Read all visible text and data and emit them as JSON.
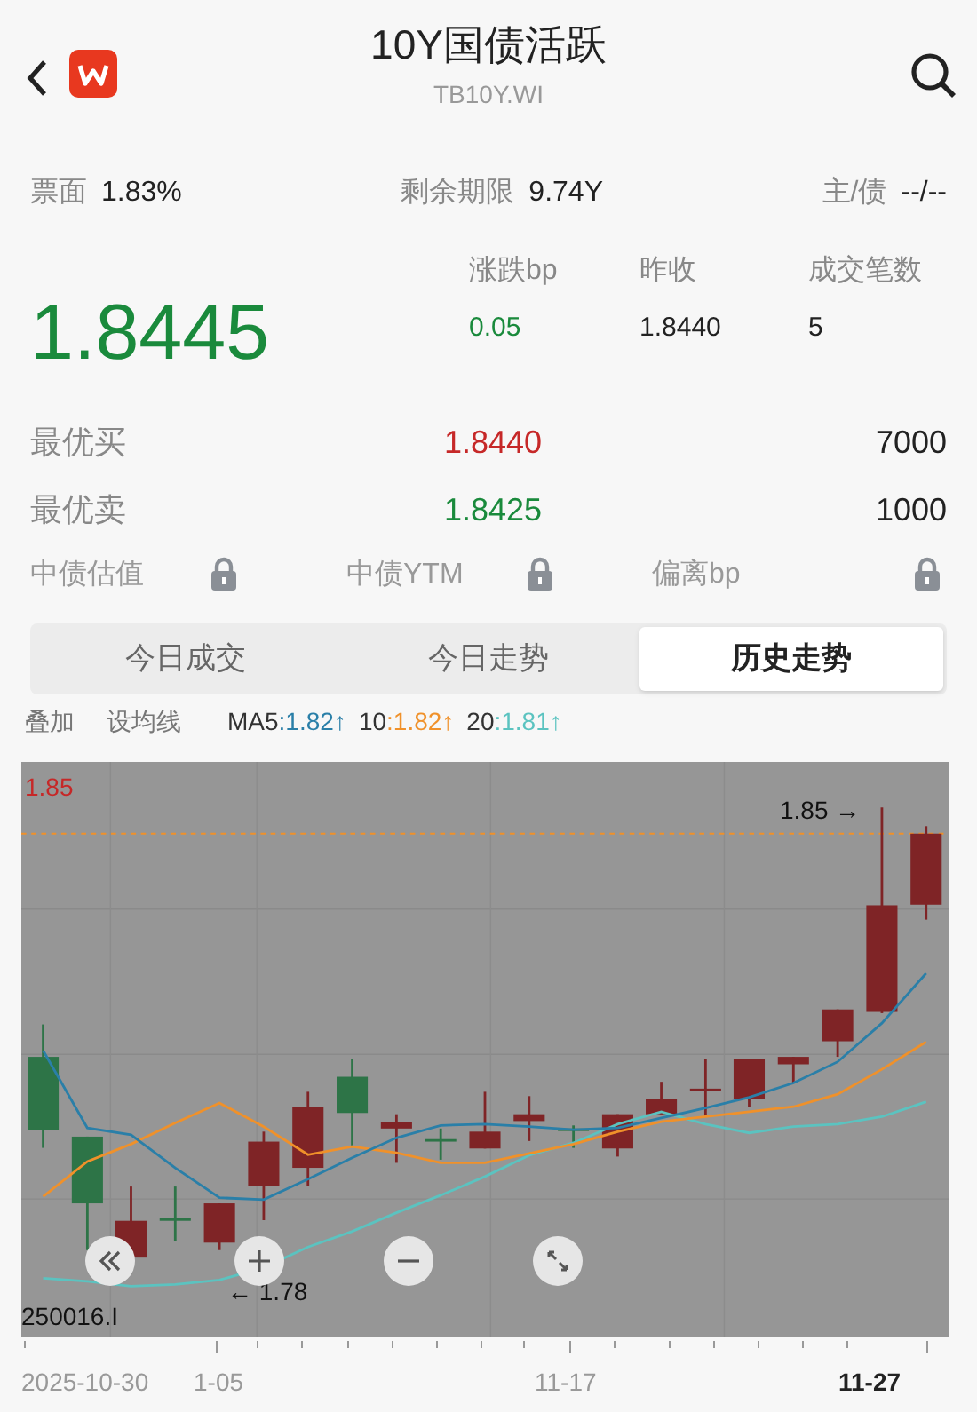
{
  "header": {
    "title": "10Y国债活跃",
    "subtitle": "TB10Y.WI"
  },
  "info": [
    {
      "label": "票面",
      "value": "1.83%"
    },
    {
      "label": "剩余期限",
      "value": "9.74Y"
    },
    {
      "label": "主/债",
      "value": "--/--"
    }
  ],
  "quote": {
    "price": "1.8445",
    "stats": [
      {
        "label": "涨跌bp",
        "value": "0.05",
        "kind": "change"
      },
      {
        "label": "昨收",
        "value": "1.8440",
        "kind": "plain"
      },
      {
        "label": "成交笔数",
        "value": "5",
        "kind": "plain"
      }
    ]
  },
  "book": [
    {
      "label": "最优买",
      "price": "1.8440",
      "color": "#c62828",
      "volume": "7000"
    },
    {
      "label": "最优卖",
      "price": "1.8425",
      "color": "#1a8a3c",
      "volume": "1000"
    }
  ],
  "locked": [
    {
      "label": "中债估值",
      "locked": true
    },
    {
      "label": "中债YTM",
      "locked": true
    },
    {
      "label": "偏离bp",
      "locked": true
    }
  ],
  "tabs": [
    {
      "label": "今日成交",
      "selected": false
    },
    {
      "label": "今日走势",
      "selected": false
    },
    {
      "label": "历史走势",
      "selected": true
    }
  ],
  "chart_bar": {
    "overlay": "叠加",
    "set_ma": "设均线",
    "ma": [
      {
        "name": "MA5",
        "value": ":1.82↑",
        "color": "#2a7fa8"
      },
      {
        "name": "10",
        "value": ":1.82↑",
        "color": "#f0912a"
      },
      {
        "name": "20",
        "value": ":1.81↑",
        "color": "#5bc3c0"
      }
    ]
  },
  "chart": {
    "top_label": "1.85",
    "high_label": "1.85 →",
    "low_label": "← 1.78",
    "code_label": "250016.I",
    "x_labels": [
      {
        "text": "2025-10-30",
        "emphasis": false
      },
      {
        "text": "1-05",
        "emphasis": false
      },
      {
        "text": "11-17",
        "emphasis": false
      },
      {
        "text": "11-27",
        "emphasis": true
      }
    ]
  }
}
